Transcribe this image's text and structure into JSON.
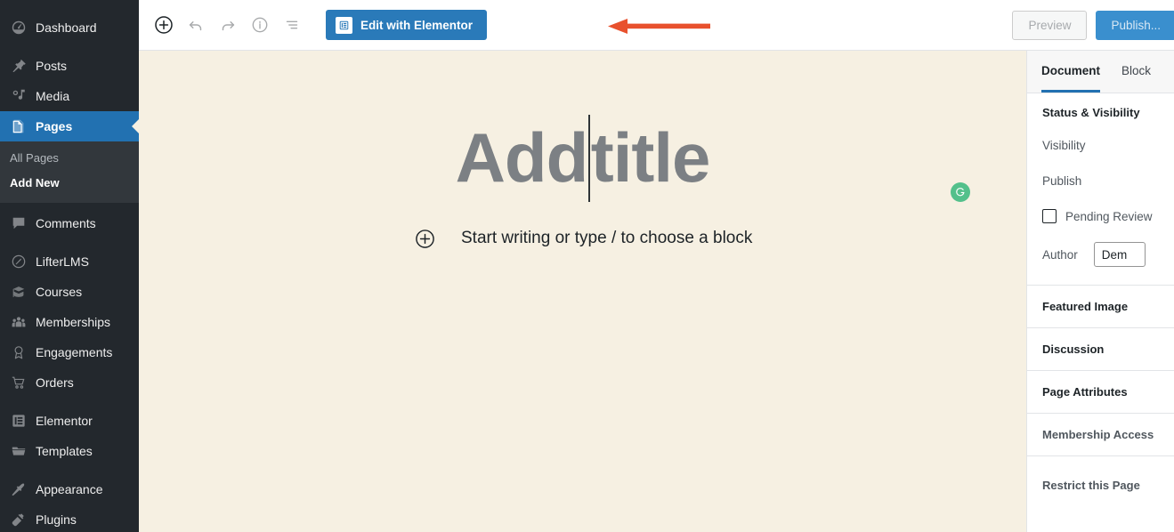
{
  "sidebar": {
    "items": [
      {
        "label": "Dashboard",
        "icon": "dashboard-icon",
        "current": false,
        "sep_after": true
      },
      {
        "label": "Posts",
        "icon": "pin-icon",
        "current": false,
        "sep_after": false
      },
      {
        "label": "Media",
        "icon": "media-icon",
        "current": false,
        "sep_after": false
      },
      {
        "label": "Pages",
        "icon": "pages-icon",
        "current": true,
        "sep_after": false
      },
      {
        "label": "Comments",
        "icon": "comments-icon",
        "current": false,
        "sep_after": true
      },
      {
        "label": "LifterLMS",
        "icon": "lifterlms-icon",
        "current": false,
        "sep_after": false
      },
      {
        "label": "Courses",
        "icon": "courses-icon",
        "current": false,
        "sep_after": false
      },
      {
        "label": "Memberships",
        "icon": "memberships-icon",
        "current": false,
        "sep_after": false
      },
      {
        "label": "Engagements",
        "icon": "engagements-icon",
        "current": false,
        "sep_after": false
      },
      {
        "label": "Orders",
        "icon": "orders-icon",
        "current": false,
        "sep_after": true
      },
      {
        "label": "Elementor",
        "icon": "elementor-icon",
        "current": false,
        "sep_after": false
      },
      {
        "label": "Templates",
        "icon": "templates-icon",
        "current": false,
        "sep_after": true
      },
      {
        "label": "Appearance",
        "icon": "appearance-icon",
        "current": false,
        "sep_after": false
      },
      {
        "label": "Plugins",
        "icon": "plugins-icon",
        "current": false,
        "sep_after": false
      }
    ],
    "submenu": {
      "all_pages": "All Pages",
      "add_new": "Add New"
    },
    "colors": {
      "background": "#23282d",
      "submenu_background": "#32373c",
      "current_background": "#2271b1"
    }
  },
  "toolbar": {
    "add_block_icon": "plus-circle-icon",
    "undo_icon": "undo-icon",
    "redo_icon": "redo-icon",
    "info_icon": "info-icon",
    "list_view_icon": "list-view-icon",
    "elementor_label": "Edit with Elementor",
    "elementor_icon": "elementor-document-icon",
    "elementor_color": "#2a7ab9",
    "preview_label": "Preview",
    "publish_label": "Publish...",
    "publish_color": "#3a8fce"
  },
  "annotation": {
    "arrow_color": "#e8512d",
    "points_to": "Edit with Elementor"
  },
  "content": {
    "title_before_caret": "Add",
    "title_after_caret": "title",
    "block_placeholder": "Start writing or type / to choose a block",
    "block_adder_icon": "plus-circle-icon",
    "grammarly_icon": "grammarly-icon",
    "grammarly_color": "#53c08b",
    "background_color": "#f6f0e2"
  },
  "inspector": {
    "tabs": [
      {
        "label": "Document",
        "active": true
      },
      {
        "label": "Block",
        "active": false
      }
    ],
    "status_panel": {
      "title": "Status & Visibility",
      "visibility_label": "Visibility",
      "publish_label": "Publish",
      "pending_review_label": "Pending Review",
      "pending_review_checked": false,
      "author_label": "Author",
      "author_value": "Dem"
    },
    "sections": [
      {
        "label": "Featured Image",
        "muted": false,
        "tall": false
      },
      {
        "label": "Discussion",
        "muted": false,
        "tall": false
      },
      {
        "label": "Page Attributes",
        "muted": false,
        "tall": false
      },
      {
        "label": "Membership Access",
        "muted": true,
        "tall": false
      },
      {
        "label": "Restrict this Page",
        "muted": true,
        "tall": true
      }
    ]
  }
}
